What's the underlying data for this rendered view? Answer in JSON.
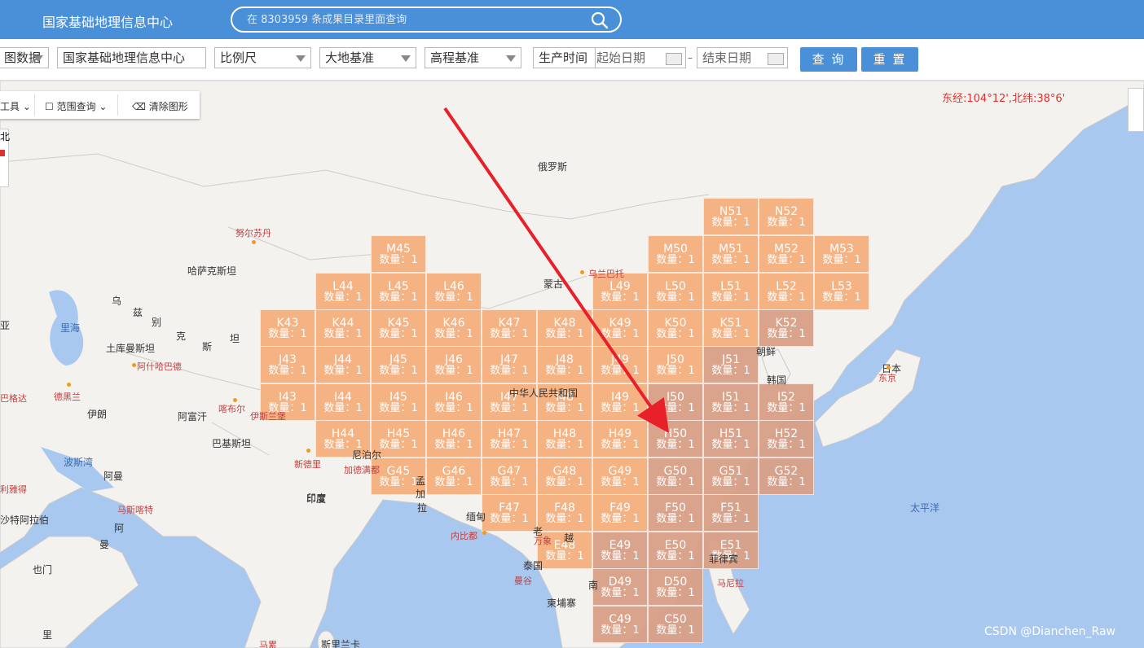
{
  "header": {
    "title": "国家基础地理信息中心",
    "search_placeholder": "在 8303959 条成果目录里面查询"
  },
  "filters": {
    "data_type": "图数据",
    "provider": "国家基础地理信息中心",
    "scale": "比例尺",
    "geodetic_datum": "大地基准",
    "height_datum": "高程基准",
    "production_time_label": "生产时间",
    "start_date_placeholder": "起始日期",
    "end_date_placeholder": "结束日期",
    "query_label": "查 询",
    "reset_label": "重 置"
  },
  "toolbar": {
    "tools_label": "工具",
    "range_query_label": "范围查询",
    "clear_label": "清除图形",
    "side_fragment": "北"
  },
  "coords_text": "东经:104°12',北纬:38°6'",
  "count_prefix": "数量：1",
  "tiles": [
    {
      "code": "N51",
      "dark": false
    },
    {
      "code": "N52",
      "dark": false
    },
    {
      "code": "M45",
      "dark": false
    },
    {
      "code": "M50",
      "dark": false
    },
    {
      "code": "M51",
      "dark": false
    },
    {
      "code": "M52",
      "dark": false
    },
    {
      "code": "M53",
      "dark": false
    },
    {
      "code": "L44",
      "dark": false
    },
    {
      "code": "L45",
      "dark": false
    },
    {
      "code": "L46",
      "dark": false
    },
    {
      "code": "L49",
      "dark": false
    },
    {
      "code": "L50",
      "dark": false
    },
    {
      "code": "L51",
      "dark": false
    },
    {
      "code": "L52",
      "dark": false
    },
    {
      "code": "L53",
      "dark": false
    },
    {
      "code": "K43",
      "dark": false
    },
    {
      "code": "K44",
      "dark": false
    },
    {
      "code": "K45",
      "dark": false
    },
    {
      "code": "K46",
      "dark": false
    },
    {
      "code": "K47",
      "dark": false
    },
    {
      "code": "K48",
      "dark": false
    },
    {
      "code": "K49",
      "dark": false
    },
    {
      "code": "K50",
      "dark": false
    },
    {
      "code": "K51",
      "dark": false
    },
    {
      "code": "K52",
      "dark": true
    },
    {
      "code": "J43",
      "dark": false
    },
    {
      "code": "J44",
      "dark": false
    },
    {
      "code": "J45",
      "dark": false
    },
    {
      "code": "J46",
      "dark": false
    },
    {
      "code": "J47",
      "dark": false
    },
    {
      "code": "J48",
      "dark": false
    },
    {
      "code": "J49",
      "dark": false
    },
    {
      "code": "J50",
      "dark": false
    },
    {
      "code": "J51",
      "dark": true
    },
    {
      "code": "I43",
      "dark": false
    },
    {
      "code": "I44",
      "dark": false
    },
    {
      "code": "I45",
      "dark": false
    },
    {
      "code": "I46",
      "dark": false
    },
    {
      "code": "I47",
      "dark": false
    },
    {
      "code": "I48",
      "dark": false
    },
    {
      "code": "I49",
      "dark": false
    },
    {
      "code": "I50",
      "dark": true
    },
    {
      "code": "I51",
      "dark": true
    },
    {
      "code": "I52",
      "dark": true
    },
    {
      "code": "H44",
      "dark": false
    },
    {
      "code": "H45",
      "dark": false
    },
    {
      "code": "H46",
      "dark": false
    },
    {
      "code": "H47",
      "dark": false
    },
    {
      "code": "H48",
      "dark": false
    },
    {
      "code": "H49",
      "dark": false
    },
    {
      "code": "H50",
      "dark": true
    },
    {
      "code": "H51",
      "dark": true
    },
    {
      "code": "H52",
      "dark": true
    },
    {
      "code": "G45",
      "dark": false
    },
    {
      "code": "G46",
      "dark": false
    },
    {
      "code": "G47",
      "dark": false
    },
    {
      "code": "G48",
      "dark": false
    },
    {
      "code": "G49",
      "dark": false
    },
    {
      "code": "G50",
      "dark": true
    },
    {
      "code": "G51",
      "dark": true
    },
    {
      "code": "G52",
      "dark": true
    },
    {
      "code": "F47",
      "dark": false
    },
    {
      "code": "F48",
      "dark": false
    },
    {
      "code": "F49",
      "dark": false
    },
    {
      "code": "F50",
      "dark": true
    },
    {
      "code": "F51",
      "dark": true
    },
    {
      "code": "E48",
      "dark": false
    },
    {
      "code": "E49",
      "dark": true
    },
    {
      "code": "E50",
      "dark": true
    },
    {
      "code": "E51",
      "dark": true
    },
    {
      "code": "D49",
      "dark": true
    },
    {
      "code": "D50",
      "dark": true
    },
    {
      "code": "C49",
      "dark": true
    },
    {
      "code": "C50",
      "dark": true
    }
  ],
  "map_labels": [
    {
      "text": "俄罗斯",
      "kind": "country"
    },
    {
      "text": "哈萨克斯坦",
      "kind": "country"
    },
    {
      "text": "蒙古",
      "kind": "country"
    },
    {
      "text": "中华人民共和国",
      "kind": "country"
    },
    {
      "text": "朝鲜",
      "kind": "country"
    },
    {
      "text": "韩国",
      "kind": "country"
    },
    {
      "text": "日本",
      "kind": "country"
    },
    {
      "text": "土库曼斯坦",
      "kind": "country"
    },
    {
      "text": "伊朗",
      "kind": "country"
    },
    {
      "text": "阿富汗",
      "kind": "country"
    },
    {
      "text": "巴基斯坦",
      "kind": "country"
    },
    {
      "text": "印度",
      "kind": "country"
    },
    {
      "text": "尼泊尔",
      "kind": "country"
    },
    {
      "text": "缅甸",
      "kind": "country"
    },
    {
      "text": "泰国",
      "kind": "country"
    },
    {
      "text": "柬埔寨",
      "kind": "country"
    },
    {
      "text": "老",
      "kind": "country"
    },
    {
      "text": "越",
      "kind": "country"
    },
    {
      "text": "南",
      "kind": "country"
    },
    {
      "text": "拉",
      "kind": "country"
    },
    {
      "text": "加",
      "kind": "country"
    },
    {
      "text": "孟",
      "kind": "country"
    },
    {
      "text": "阿曼",
      "kind": "country"
    },
    {
      "text": "也门",
      "kind": "country"
    },
    {
      "text": "沙特阿拉伯",
      "kind": "country"
    },
    {
      "text": "乌",
      "kind": "country"
    },
    {
      "text": "兹",
      "kind": "country"
    },
    {
      "text": "别",
      "kind": "country"
    },
    {
      "text": "克",
      "kind": "country"
    },
    {
      "text": "斯",
      "kind": "country"
    },
    {
      "text": "坦",
      "kind": "country"
    },
    {
      "text": "亚",
      "kind": "country"
    },
    {
      "text": "阿",
      "kind": "country"
    },
    {
      "text": "曼",
      "kind": "country"
    },
    {
      "text": "里",
      "kind": "country"
    },
    {
      "text": "斯里兰卡",
      "kind": "country"
    },
    {
      "text": "菲律宾",
      "kind": "country"
    },
    {
      "text": "印度",
      "kind": "country"
    },
    {
      "text": "里海",
      "kind": "sea"
    },
    {
      "text": "波斯湾",
      "kind": "sea"
    },
    {
      "text": "太平洋",
      "kind": "sea"
    },
    {
      "text": "努尔苏丹",
      "kind": "city"
    },
    {
      "text": "乌兰巴托",
      "kind": "city"
    },
    {
      "text": "阿什哈巴德",
      "kind": "city"
    },
    {
      "text": "德黑兰",
      "kind": "city"
    },
    {
      "text": "喀布尔",
      "kind": "city"
    },
    {
      "text": "伊斯兰堡",
      "kind": "city"
    },
    {
      "text": "新德里",
      "kind": "city"
    },
    {
      "text": "加德满都",
      "kind": "city"
    },
    {
      "text": "内比都",
      "kind": "city"
    },
    {
      "text": "万象",
      "kind": "city"
    },
    {
      "text": "曼谷",
      "kind": "city"
    },
    {
      "text": "马尼拉",
      "kind": "city"
    },
    {
      "text": "东京",
      "kind": "city"
    },
    {
      "text": "马斯喀特",
      "kind": "city"
    },
    {
      "text": "利雅得",
      "kind": "city"
    },
    {
      "text": "巴格达",
      "kind": "city"
    },
    {
      "text": "马累",
      "kind": "city"
    }
  ],
  "watermark": "CSDN @Dianchen_Raw",
  "colors": {
    "header": "#4a90d9",
    "tile": "#f6b07f",
    "tile_dark": "#d9a087",
    "arrow": "#e8202a",
    "sea": "#a9c8ef",
    "land": "#f4f2ee"
  }
}
